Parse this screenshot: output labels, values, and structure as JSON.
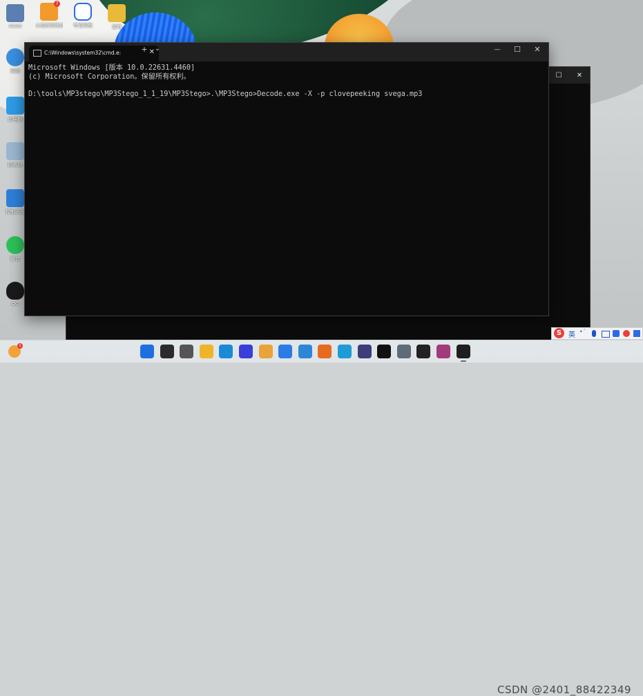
{
  "desktop": {
    "icons": [
      {
        "label": "ASUS",
        "color": "#5a7fb0"
      },
      {
        "label": "火绒应用商店",
        "color": "#f29a2c",
        "badge": "7"
      },
      {
        "label": "夸克网盘",
        "color": "#2b6be6"
      },
      {
        "label": "游戏",
        "color": "#e9b93a"
      },
      {
        "label": "网络",
        "color": "#3a8fe0"
      },
      {
        "label": "此电脑",
        "color": "#2e9be6"
      },
      {
        "label": "回收站",
        "color": "#9bb7d0"
      },
      {
        "label": "控制面板",
        "color": "#2f7fd8"
      },
      {
        "label": "微信",
        "color": "#2dc15a"
      },
      {
        "label": "QQ",
        "color": "#1a1a1a"
      }
    ]
  },
  "back_window": {
    "maximize_glyph": "☐",
    "close_glyph": "✕"
  },
  "terminal": {
    "tab_title": "C:\\Windows\\system32\\cmd.e:",
    "tab_close_glyph": "✕",
    "new_tab_glyph": "+",
    "dropdown_glyph": "⌄",
    "minimize_glyph": "—",
    "maximize_glyph": "☐",
    "close_glyph": "✕",
    "lines": [
      "Microsoft Windows [版本 10.0.22631.4460]",
      "(c) Microsoft Corporation。保留所有权利。",
      "",
      "D:\\tools\\MP3stego\\MP3Stego_1_1_19\\MP3Stego>.\\MP3Stego>Decode.exe -X -p clovepeeking svega.mp3"
    ]
  },
  "taskbar": {
    "notification_badge": "1",
    "apps": [
      {
        "name": "start",
        "color": "#1f6fe0",
        "active": false
      },
      {
        "name": "search",
        "color": "#2b2b2b",
        "active": false
      },
      {
        "name": "task-view",
        "color": "#555555",
        "active": false
      },
      {
        "name": "file-explorer",
        "color": "#f0b429",
        "active": false
      },
      {
        "name": "edge",
        "color": "#1b8ad6",
        "active": false
      },
      {
        "name": "pen-app",
        "color": "#3a3fd8",
        "active": false
      },
      {
        "name": "store",
        "color": "#e8a33a",
        "active": false
      },
      {
        "name": "app-a",
        "color": "#2c7be5",
        "active": false
      },
      {
        "name": "bird-app",
        "color": "#2f86d9",
        "active": false
      },
      {
        "name": "firefox",
        "color": "#e66b1f",
        "active": false
      },
      {
        "name": "box-app",
        "color": "#1e9bd4",
        "active": false
      },
      {
        "name": "qr-app",
        "color": "#3d3d7a",
        "active": false
      },
      {
        "name": "burp-app",
        "color": "#111111",
        "active": false
      },
      {
        "name": "settings",
        "color": "#5f6b78",
        "active": false
      },
      {
        "name": "typora",
        "color": "#222222",
        "active": false
      },
      {
        "name": "winrar",
        "color": "#a33b7a",
        "active": false
      },
      {
        "name": "terminal",
        "color": "#1e1e1e",
        "active": true
      }
    ],
    "ime": {
      "logo": "S",
      "lang": "英",
      "extra": "•ˊ"
    },
    "watermark": "CSDN @2401_88422349"
  },
  "colors": {
    "console_bg": "#0c0c0c",
    "console_text": "#cccccc",
    "titlebar": "#202020"
  }
}
